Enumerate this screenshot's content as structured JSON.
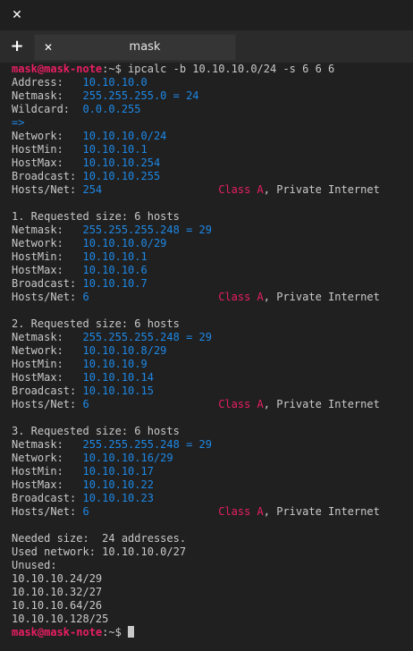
{
  "window": {
    "close_icon": "close-icon"
  },
  "tabbar": {
    "new_tab_icon": "plus-icon",
    "tab_title": "mask",
    "tab_close_icon": "close-icon"
  },
  "colors": {
    "prompt": "#e91e63",
    "value": "#1e88e5",
    "class": "#e91e63",
    "text": "#c9c9c9",
    "bg": "#202020"
  },
  "terminal": {
    "lines": [
      [
        {
          "t": "mask@mask-note",
          "c": "prompt"
        },
        {
          "t": ":~$ ipcalc -b 10.10.10.0/24 -s 6 6 6",
          "c": "default"
        }
      ],
      [
        {
          "t": "Address:   ",
          "c": "default"
        },
        {
          "t": "10.10.10.0",
          "c": "blue"
        }
      ],
      [
        {
          "t": "Netmask:   ",
          "c": "default"
        },
        {
          "t": "255.255.255.0 = 24",
          "c": "blue"
        }
      ],
      [
        {
          "t": "Wildcard:  ",
          "c": "default"
        },
        {
          "t": "0.0.0.255",
          "c": "blue"
        }
      ],
      [
        {
          "t": "=>",
          "c": "blue"
        }
      ],
      [
        {
          "t": "Network:   ",
          "c": "default"
        },
        {
          "t": "10.10.10.0/24",
          "c": "blue"
        }
      ],
      [
        {
          "t": "HostMin:   ",
          "c": "default"
        },
        {
          "t": "10.10.10.1",
          "c": "blue"
        }
      ],
      [
        {
          "t": "HostMax:   ",
          "c": "default"
        },
        {
          "t": "10.10.10.254",
          "c": "blue"
        }
      ],
      [
        {
          "t": "Broadcast: ",
          "c": "default"
        },
        {
          "t": "10.10.10.255",
          "c": "blue"
        }
      ],
      [
        {
          "t": "Hosts/Net: ",
          "c": "default"
        },
        {
          "t": "254                  ",
          "c": "blue"
        },
        {
          "t": "Class A",
          "c": "red"
        },
        {
          "t": ", Private Internet",
          "c": "default"
        }
      ],
      [],
      [
        {
          "t": "1. Requested size: 6 hosts",
          "c": "default"
        }
      ],
      [
        {
          "t": "Netmask:   ",
          "c": "default"
        },
        {
          "t": "255.255.255.248 = 29",
          "c": "blue"
        }
      ],
      [
        {
          "t": "Network:   ",
          "c": "default"
        },
        {
          "t": "10.10.10.0/29",
          "c": "blue"
        }
      ],
      [
        {
          "t": "HostMin:   ",
          "c": "default"
        },
        {
          "t": "10.10.10.1",
          "c": "blue"
        }
      ],
      [
        {
          "t": "HostMax:   ",
          "c": "default"
        },
        {
          "t": "10.10.10.6",
          "c": "blue"
        }
      ],
      [
        {
          "t": "Broadcast: ",
          "c": "default"
        },
        {
          "t": "10.10.10.7",
          "c": "blue"
        }
      ],
      [
        {
          "t": "Hosts/Net: ",
          "c": "default"
        },
        {
          "t": "6                    ",
          "c": "blue"
        },
        {
          "t": "Class A",
          "c": "red"
        },
        {
          "t": ", Private Internet",
          "c": "default"
        }
      ],
      [],
      [
        {
          "t": "2. Requested size: 6 hosts",
          "c": "default"
        }
      ],
      [
        {
          "t": "Netmask:   ",
          "c": "default"
        },
        {
          "t": "255.255.255.248 = 29",
          "c": "blue"
        }
      ],
      [
        {
          "t": "Network:   ",
          "c": "default"
        },
        {
          "t": "10.10.10.8/29",
          "c": "blue"
        }
      ],
      [
        {
          "t": "HostMin:   ",
          "c": "default"
        },
        {
          "t": "10.10.10.9",
          "c": "blue"
        }
      ],
      [
        {
          "t": "HostMax:   ",
          "c": "default"
        },
        {
          "t": "10.10.10.14",
          "c": "blue"
        }
      ],
      [
        {
          "t": "Broadcast: ",
          "c": "default"
        },
        {
          "t": "10.10.10.15",
          "c": "blue"
        }
      ],
      [
        {
          "t": "Hosts/Net: ",
          "c": "default"
        },
        {
          "t": "6                    ",
          "c": "blue"
        },
        {
          "t": "Class A",
          "c": "red"
        },
        {
          "t": ", Private Internet",
          "c": "default"
        }
      ],
      [],
      [
        {
          "t": "3. Requested size: 6 hosts",
          "c": "default"
        }
      ],
      [
        {
          "t": "Netmask:   ",
          "c": "default"
        },
        {
          "t": "255.255.255.248 = 29",
          "c": "blue"
        }
      ],
      [
        {
          "t": "Network:   ",
          "c": "default"
        },
        {
          "t": "10.10.10.16/29",
          "c": "blue"
        }
      ],
      [
        {
          "t": "HostMin:   ",
          "c": "default"
        },
        {
          "t": "10.10.10.17",
          "c": "blue"
        }
      ],
      [
        {
          "t": "HostMax:   ",
          "c": "default"
        },
        {
          "t": "10.10.10.22",
          "c": "blue"
        }
      ],
      [
        {
          "t": "Broadcast: ",
          "c": "default"
        },
        {
          "t": "10.10.10.23",
          "c": "blue"
        }
      ],
      [
        {
          "t": "Hosts/Net: ",
          "c": "default"
        },
        {
          "t": "6                    ",
          "c": "blue"
        },
        {
          "t": "Class A",
          "c": "red"
        },
        {
          "t": ", Private Internet",
          "c": "default"
        }
      ],
      [],
      [
        {
          "t": "Needed size:  24 addresses.",
          "c": "default"
        }
      ],
      [
        {
          "t": "Used network: 10.10.10.0/27",
          "c": "default"
        }
      ],
      [
        {
          "t": "Unused:",
          "c": "default"
        }
      ],
      [
        {
          "t": "10.10.10.24/29",
          "c": "default"
        }
      ],
      [
        {
          "t": "10.10.10.32/27",
          "c": "default"
        }
      ],
      [
        {
          "t": "10.10.10.64/26",
          "c": "default"
        }
      ],
      [
        {
          "t": "10.10.10.128/25",
          "c": "default"
        }
      ],
      [
        {
          "t": "mask@mask-note",
          "c": "prompt"
        },
        {
          "t": ":~$ ",
          "c": "default"
        }
      ]
    ]
  }
}
